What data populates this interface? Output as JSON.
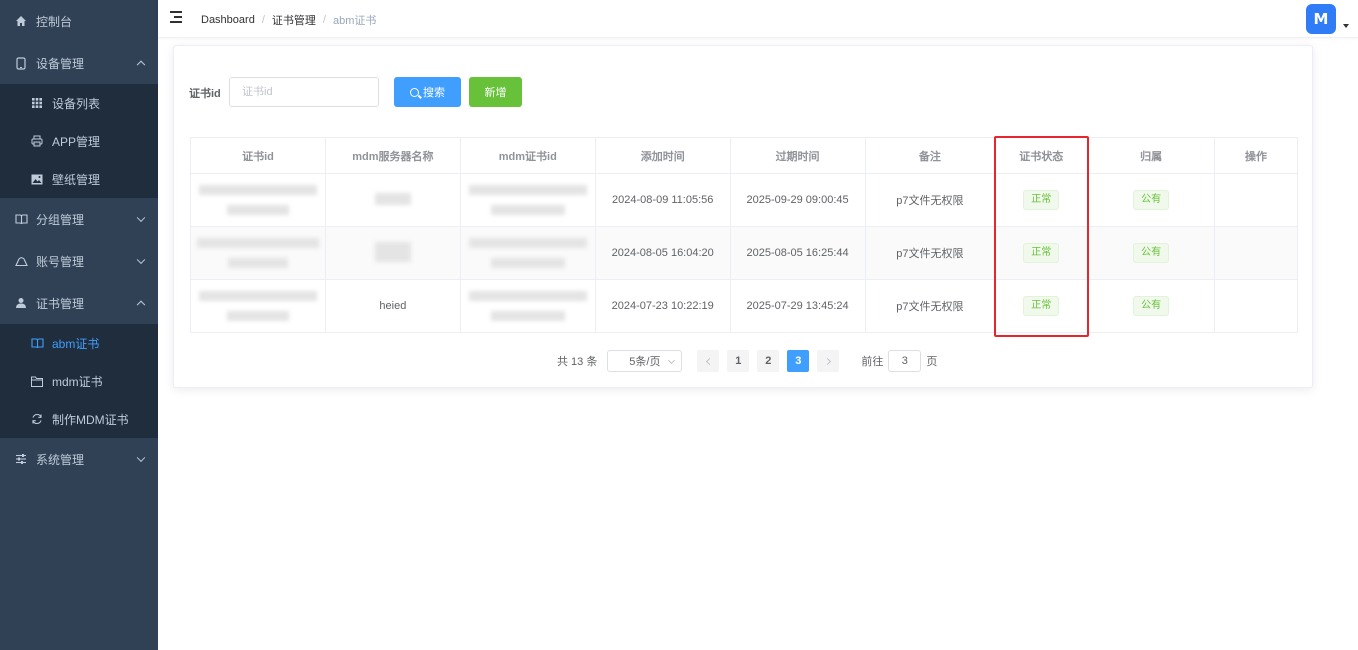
{
  "sidebar": {
    "items": [
      {
        "label": "控制台",
        "icon": "home-icon"
      },
      {
        "label": "设备管理",
        "icon": "tablet-icon",
        "expanded": true,
        "children": [
          {
            "label": "设备列表",
            "icon": "grid-icon"
          },
          {
            "label": "APP管理",
            "icon": "printer-icon"
          },
          {
            "label": "壁纸管理",
            "icon": "picture-icon"
          }
        ]
      },
      {
        "label": "分组管理",
        "icon": "book-icon",
        "expanded": false
      },
      {
        "label": "账号管理",
        "icon": "cloud-icon",
        "expanded": false
      },
      {
        "label": "证书管理",
        "icon": "user-icon",
        "expanded": true,
        "children": [
          {
            "label": "abm证书",
            "icon": "notebook-icon",
            "active": true
          },
          {
            "label": "mdm证书",
            "icon": "folder-icon"
          },
          {
            "label": "制作MDM证书",
            "icon": "refresh-icon"
          }
        ]
      },
      {
        "label": "系统管理",
        "icon": "sliders-icon",
        "expanded": false
      }
    ]
  },
  "header": {
    "breadcrumb": [
      "Dashboard",
      "证书管理",
      "abm证书"
    ],
    "avatar_logo": "M"
  },
  "search": {
    "label": "证书id",
    "placeholder": "证书id",
    "value": "",
    "search_button": "搜索",
    "add_button": "新增"
  },
  "table": {
    "columns": [
      "证书id",
      "mdm服务器名称",
      "mdm证书id",
      "添加时间",
      "过期时间",
      "备注",
      "证书状态",
      "归属",
      "操作"
    ],
    "rows": [
      {
        "cert_id": "",
        "server_name": "",
        "mdm_cert_id": "",
        "added": "2024-08-09 11:05:56",
        "expires": "2025-09-29 09:00:45",
        "remark": "p7文件无权限",
        "status": "正常",
        "owner": "公有",
        "action": ""
      },
      {
        "cert_id": "",
        "server_name": "",
        "mdm_cert_id": "",
        "added": "2024-08-05 16:04:20",
        "expires": "2025-08-05 16:25:44",
        "remark": "p7文件无权限",
        "status": "正常",
        "owner": "公有",
        "action": ""
      },
      {
        "cert_id": "",
        "server_name": "heied",
        "mdm_cert_id": "",
        "added": "2024-07-23 10:22:19",
        "expires": "2025-07-29 13:45:24",
        "remark": "p7文件无权限",
        "status": "正常",
        "owner": "公有",
        "action": ""
      }
    ]
  },
  "pagination": {
    "total_text": "共 13 条",
    "page_size": "5条/页",
    "pages": [
      "1",
      "2",
      "3"
    ],
    "current": "3",
    "jump_prefix": "前往",
    "jump_value": "3",
    "jump_suffix": "页"
  },
  "colors": {
    "sidebar_bg": "#304156",
    "submenu_bg": "#1f2d3d",
    "primary": "#409eff",
    "success": "#67c23a",
    "highlight": "#e5262e"
  }
}
